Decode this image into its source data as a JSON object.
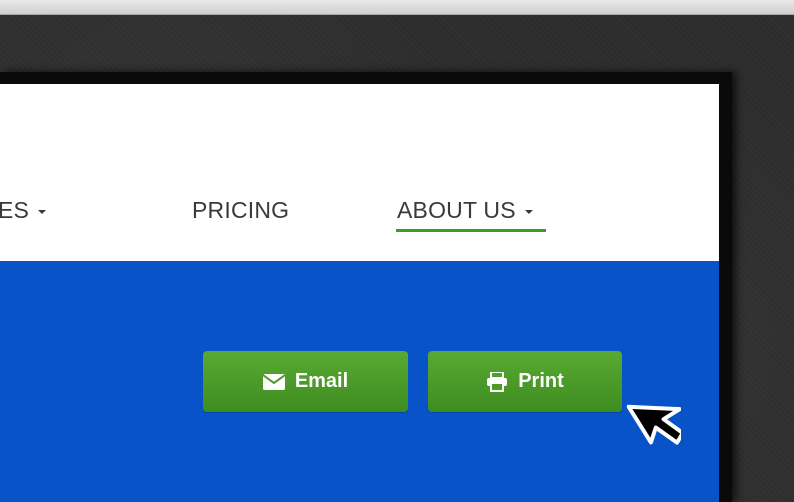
{
  "nav": {
    "services_partial": "ES",
    "pricing": "PRICING",
    "about": "ABOUT US"
  },
  "actions": {
    "email_label": "Email",
    "print_label": "Print"
  },
  "icons": {
    "email": "envelope-icon",
    "print": "printer-icon",
    "dropdown": "caret-down-icon",
    "cursor": "mouse-pointer-icon"
  },
  "colors": {
    "hero_blue": "#0753c7",
    "button_green": "#4b9a28",
    "nav_active_underline": "#3f9a2c",
    "nav_text": "#3a3a3a"
  }
}
